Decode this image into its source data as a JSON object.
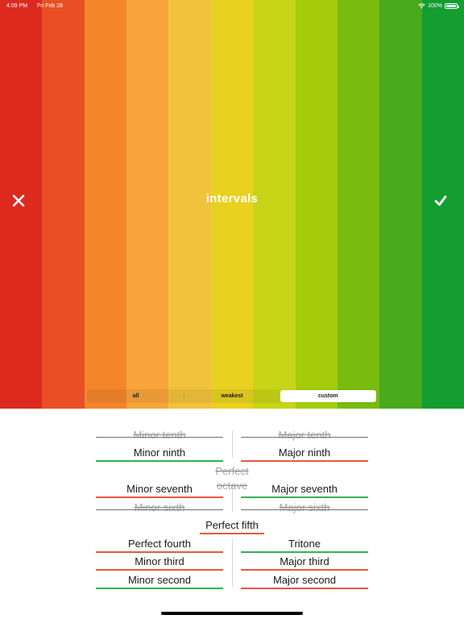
{
  "status_bar": {
    "time": "4:09 PM",
    "date": "Fri Feb 28",
    "battery": "100%"
  },
  "header": {
    "title": "intervals",
    "close_icon": "close-icon",
    "confirm_icon": "check-icon"
  },
  "stripe_colors": [
    "#dd2a1f",
    "#e94f25",
    "#f4852b",
    "#f8a43a",
    "#f3c23c",
    "#e8d120",
    "#c6d517",
    "#a4cc0b",
    "#79bb0f",
    "#4aa91c",
    "#139e2f"
  ],
  "filter": {
    "options": [
      "all",
      "weakest",
      "custom"
    ],
    "selected": "custom"
  },
  "intervals": {
    "minor_tenth": "Minor tenth",
    "major_tenth": "Major tenth",
    "minor_ninth": "Minor ninth",
    "major_ninth": "Major ninth",
    "perfect_octave": "Perfect octave",
    "minor_seventh": "Minor seventh",
    "major_seventh": "Major seventh",
    "minor_sixth": "Minor sixth",
    "major_sixth": "Major sixth",
    "perfect_fifth": "Perfect fifth",
    "perfect_fourth": "Perfect fourth",
    "tritone": "Tritone",
    "minor_third": "Minor third",
    "major_third": "Major third",
    "minor_second": "Minor second",
    "major_second": "Major second"
  },
  "colors": {
    "strong": "#2fb352",
    "weak": "#e65a3c",
    "disabled": "#a9a9a9"
  }
}
